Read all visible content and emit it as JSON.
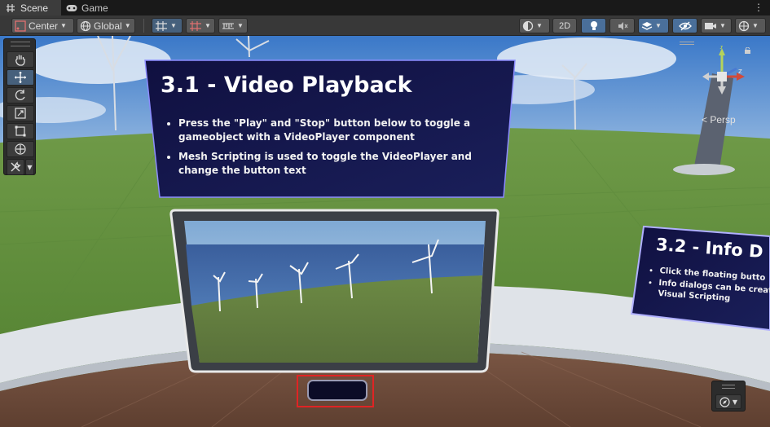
{
  "tabs": [
    {
      "label": "Scene",
      "icon": "hash-grid-icon",
      "active": true
    },
    {
      "label": "Game",
      "icon": "gamepad-icon",
      "active": false
    }
  ],
  "toolbar": {
    "pivot_label": "Center",
    "space_label": "Global",
    "mode_2d_label": "2D"
  },
  "scene": {
    "camera_mode": "< Persp",
    "panel_main": {
      "title": "3.1 - Video Playback",
      "bullets": [
        "Press the \"Play\" and \"Stop\" button below to toggle a gameobject with a VideoPlayer component",
        "Mesh Scripting is used to toggle the VideoPlayer and change the button text"
      ]
    },
    "panel_side": {
      "title": "3.2 - Info D",
      "bullets": [
        "Click the floating butto",
        "Info dialogs can be creat Visual Scripting"
      ]
    },
    "toggle_button_text": ""
  },
  "colors": {
    "panel_bg": "#0f0f3a",
    "highlight": "#e02424",
    "toolbar_bg": "#383838",
    "selected_tool": "#46607c"
  }
}
